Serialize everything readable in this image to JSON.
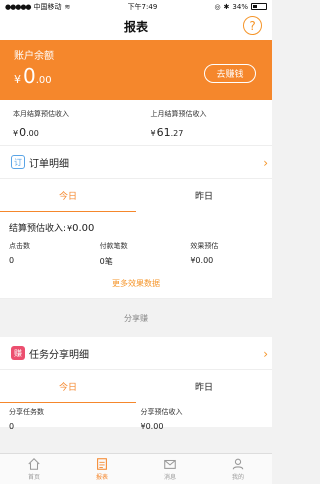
{
  "status_bar": {
    "carrier": "中国移动",
    "time": "下午7:49",
    "battery": "34%",
    "battery_level": 0.34
  },
  "nav": {
    "title": "报表",
    "help_label": "?"
  },
  "balance": {
    "label": "账户余额",
    "currency": "¥",
    "integer": "0",
    "decimal": ".00",
    "withdraw_label": "去赚钱"
  },
  "income": {
    "this_month": {
      "label": "本月结算预估收入",
      "currency": "¥",
      "integer": "0",
      "decimal": ".00"
    },
    "last_month": {
      "label": "上月结算预估收入",
      "currency": "¥",
      "integer": "61",
      "decimal": ".27"
    }
  },
  "order_detail": {
    "title": "订单明细",
    "icon": "订",
    "tabs": [
      "今日",
      "昨日"
    ],
    "settle_label": "结算预估收入:",
    "settle_currency": "¥",
    "settle_value": "0.00",
    "stats": [
      {
        "label": "点击数",
        "value": "0"
      },
      {
        "label": "付款笔数",
        "value": "0笔"
      },
      {
        "label": "效果预估",
        "value": "¥0.00"
      }
    ],
    "more_label": "更多效果数据"
  },
  "share_section_label": "分享赚",
  "task_detail": {
    "title": "任务分享明细",
    "icon": "赚",
    "tabs": [
      "今日",
      "昨日"
    ],
    "stats": [
      {
        "label": "分享任务数",
        "value": "0"
      },
      {
        "label": "分享预估收入",
        "value": "¥0.00"
      }
    ]
  },
  "tab_bar": [
    {
      "label": "首页",
      "icon": "home-icon",
      "active": false
    },
    {
      "label": "报表",
      "icon": "report-icon",
      "active": true
    },
    {
      "label": "消息",
      "icon": "message-icon",
      "active": false
    },
    {
      "label": "我的",
      "icon": "profile-icon",
      "active": false
    }
  ],
  "colors": {
    "accent": "#f5872c",
    "background": "#f2f2f2"
  }
}
